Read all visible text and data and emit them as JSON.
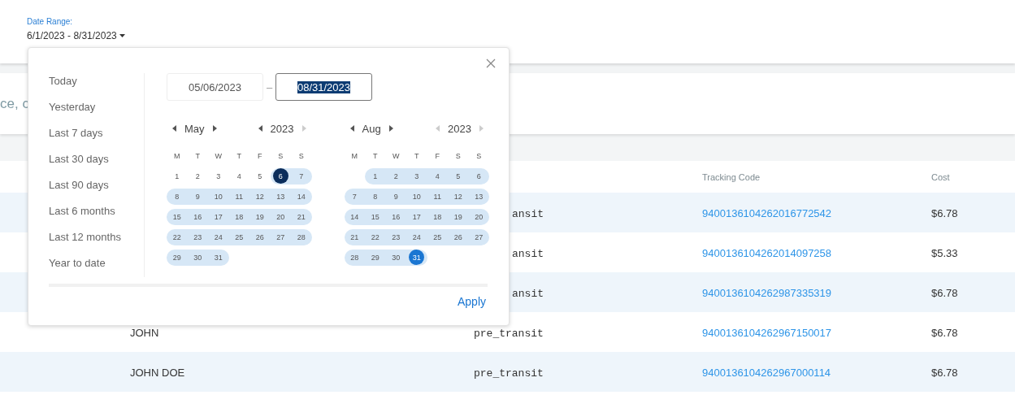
{
  "filter": {
    "label": "Date Range:",
    "value": "6/1/2023 - 8/31/2023"
  },
  "search": {
    "placeholder": "ce, c"
  },
  "table": {
    "columns": [
      "Tracking Code",
      "Cost"
    ],
    "rows": [
      {
        "status": "ansit",
        "tracking": "9400136104262016772542",
        "cost": "$6.78"
      },
      {
        "status": "ansit",
        "tracking": "9400136104262014097258",
        "cost": "$5.33"
      },
      {
        "status": "ansit",
        "tracking": "9400136104262987335319",
        "cost": "$6.78"
      },
      {
        "name": "JOHN",
        "status": "pre_transit",
        "tracking": "9400136104262967150017",
        "cost": "$6.78"
      },
      {
        "name": "JOHN DOE",
        "status": "pre_transit",
        "tracking": "9400136104262967000114",
        "cost": "$6.78"
      }
    ]
  },
  "picker": {
    "presets": [
      "Today",
      "Yesterday",
      "Last 7 days",
      "Last 30 days",
      "Last 90 days",
      "Last 6 months",
      "Last 12 months",
      "Year to date"
    ],
    "from": {
      "value": "05/06/2023",
      "focused": false,
      "text_selected": false
    },
    "separator": "–",
    "to": {
      "value": "08/31/2023",
      "focused": true,
      "text_selected": true
    },
    "calendars": [
      {
        "month": "May",
        "year": "2023",
        "year_prev_disabled": false,
        "year_next_disabled": true,
        "weekdays": [
          "M",
          "T",
          "W",
          "T",
          "F",
          "S",
          "S"
        ],
        "days": [
          {
            "day": "1",
            "kind": "none"
          },
          {
            "day": "2",
            "kind": "none"
          },
          {
            "day": "3",
            "kind": "none"
          },
          {
            "day": "4",
            "kind": "none"
          },
          {
            "day": "5",
            "kind": "none"
          },
          {
            "day": "6",
            "kind": "start"
          },
          {
            "day": "7",
            "kind": "range"
          },
          {
            "day": "8",
            "kind": "range"
          },
          {
            "day": "9",
            "kind": "range"
          },
          {
            "day": "10",
            "kind": "range"
          },
          {
            "day": "11",
            "kind": "range"
          },
          {
            "day": "12",
            "kind": "range"
          },
          {
            "day": "13",
            "kind": "range"
          },
          {
            "day": "14",
            "kind": "range"
          },
          {
            "day": "15",
            "kind": "range"
          },
          {
            "day": "16",
            "kind": "range"
          },
          {
            "day": "17",
            "kind": "range"
          },
          {
            "day": "18",
            "kind": "range"
          },
          {
            "day": "19",
            "kind": "range"
          },
          {
            "day": "20",
            "kind": "range"
          },
          {
            "day": "21",
            "kind": "range"
          },
          {
            "day": "22",
            "kind": "range"
          },
          {
            "day": "23",
            "kind": "range"
          },
          {
            "day": "24",
            "kind": "range"
          },
          {
            "day": "25",
            "kind": "range"
          },
          {
            "day": "26",
            "kind": "range"
          },
          {
            "day": "27",
            "kind": "range"
          },
          {
            "day": "28",
            "kind": "range"
          },
          {
            "day": "29",
            "kind": "range"
          },
          {
            "day": "30",
            "kind": "range"
          },
          {
            "day": "31",
            "kind": "range"
          }
        ]
      },
      {
        "month": "Aug",
        "year": "2023",
        "year_prev_disabled": true,
        "year_next_disabled": true,
        "weekdays": [
          "M",
          "T",
          "W",
          "T",
          "F",
          "S",
          "S"
        ],
        "days": [
          {
            "kind": "blank"
          },
          {
            "day": "1",
            "kind": "range"
          },
          {
            "day": "2",
            "kind": "range"
          },
          {
            "day": "3",
            "kind": "range"
          },
          {
            "day": "4",
            "kind": "range"
          },
          {
            "day": "5",
            "kind": "range"
          },
          {
            "day": "6",
            "kind": "range"
          },
          {
            "day": "7",
            "kind": "range"
          },
          {
            "day": "8",
            "kind": "range"
          },
          {
            "day": "9",
            "kind": "range"
          },
          {
            "day": "10",
            "kind": "range"
          },
          {
            "day": "11",
            "kind": "range"
          },
          {
            "day": "12",
            "kind": "range"
          },
          {
            "day": "13",
            "kind": "range"
          },
          {
            "day": "14",
            "kind": "range"
          },
          {
            "day": "15",
            "kind": "range"
          },
          {
            "day": "16",
            "kind": "range"
          },
          {
            "day": "17",
            "kind": "range"
          },
          {
            "day": "18",
            "kind": "range"
          },
          {
            "day": "19",
            "kind": "range"
          },
          {
            "day": "20",
            "kind": "range"
          },
          {
            "day": "21",
            "kind": "range"
          },
          {
            "day": "22",
            "kind": "range"
          },
          {
            "day": "23",
            "kind": "range"
          },
          {
            "day": "24",
            "kind": "range"
          },
          {
            "day": "25",
            "kind": "range"
          },
          {
            "day": "26",
            "kind": "range"
          },
          {
            "day": "27",
            "kind": "range"
          },
          {
            "day": "28",
            "kind": "range"
          },
          {
            "day": "29",
            "kind": "range"
          },
          {
            "day": "30",
            "kind": "range"
          },
          {
            "day": "31",
            "kind": "end"
          }
        ]
      }
    ],
    "apply": "Apply"
  }
}
